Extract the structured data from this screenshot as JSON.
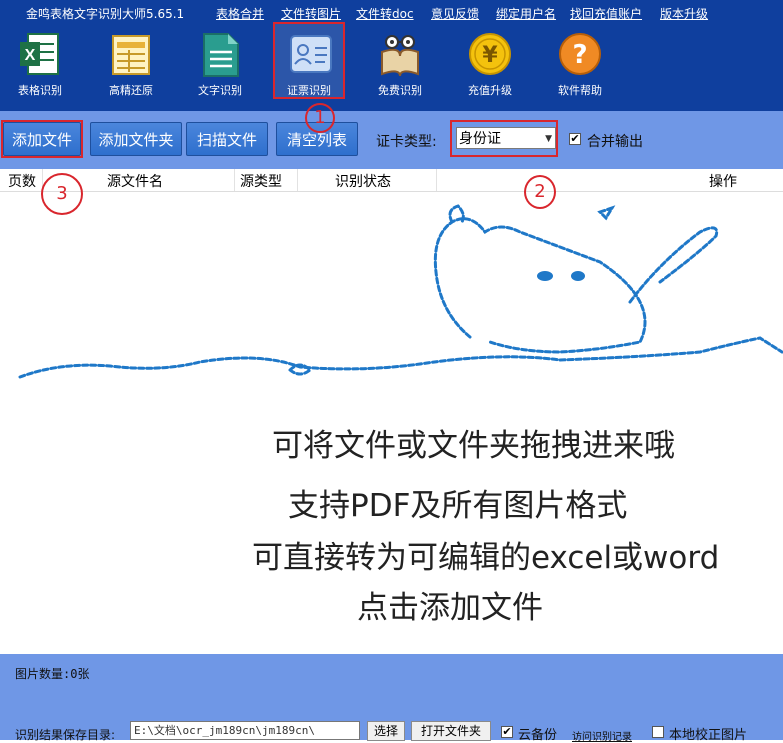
{
  "app": {
    "title": "金鸣表格文字识别大师5.65.1"
  },
  "menu": [
    "表格合并",
    "文件转图片",
    "文件转doc",
    "意见反馈",
    "绑定用户名",
    "找回充值账户",
    "版本升级"
  ],
  "tools": [
    {
      "label": "表格识别",
      "icon": "excel-icon"
    },
    {
      "label": "高精还原",
      "icon": "table-restore-icon"
    },
    {
      "label": "文字识别",
      "icon": "document-icon"
    },
    {
      "label": "证票识别",
      "icon": "id-card-icon",
      "selected": true
    },
    {
      "label": "免费识别",
      "icon": "book-glasses-icon"
    },
    {
      "label": "充值升级",
      "icon": "yen-coin-icon"
    },
    {
      "label": "软件帮助",
      "icon": "help-icon"
    }
  ],
  "toolbar": {
    "add_file": "添加文件",
    "add_folder": "添加文件夹",
    "scan_file": "扫描文件",
    "clear_list": "清空列表",
    "card_type_label": "证卡类型:",
    "card_type_value": "身份证",
    "merge_label": "合并输出",
    "merge_checked": true
  },
  "table": {
    "columns": [
      "页数",
      "源文件名",
      "源类型",
      "识别状态",
      "操作"
    ]
  },
  "drop_area": {
    "lines": [
      "可将文件或文件夹拖拽进来哦",
      "支持PDF及所有图片格式",
      "可直接转为可编辑的excel或word",
      "点击添加文件"
    ]
  },
  "bottom": {
    "image_count": "图片数量:0张",
    "save_dir_label": "识别结果保存目录:",
    "save_dir_value": "E:\\文档\\ocr_jm189cn\\jm189cn\\",
    "browse": "选择",
    "open_folder": "打开文件夹",
    "cloud_backup": "云备份",
    "cloud_backup_checked": true,
    "view_records": "访问识别记录",
    "local_correct": "本地校正图片",
    "local_correct_checked": false
  },
  "annotations": [
    "1",
    "2",
    "3"
  ],
  "colors": {
    "header": "#0f3f9e",
    "toolbar": "#6f97e6",
    "button": "#2e6fcd",
    "annotation": "#d9262d",
    "doodle": "#1f78c8"
  }
}
